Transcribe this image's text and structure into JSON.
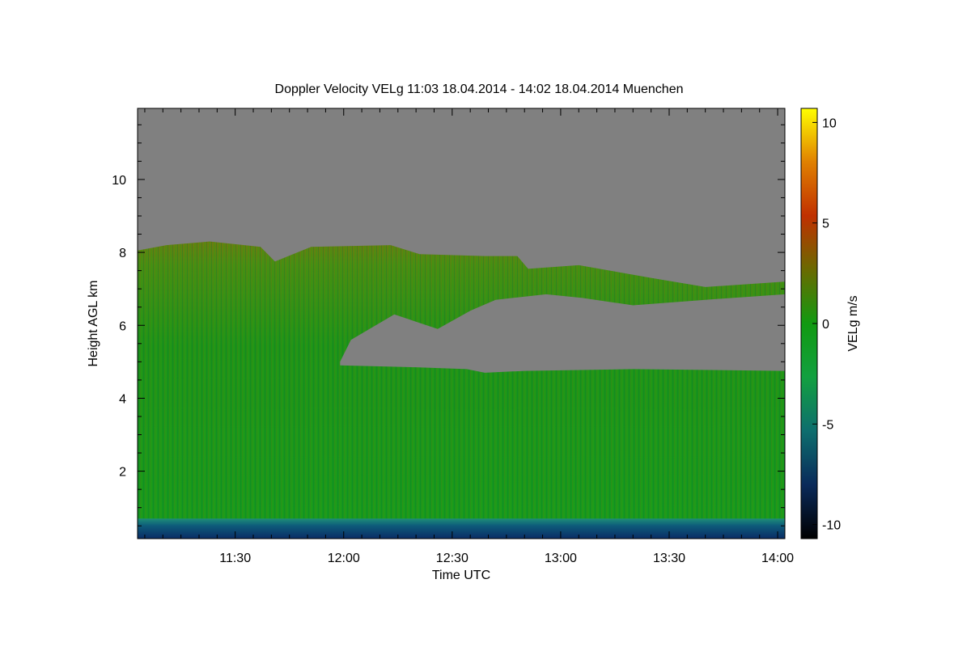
{
  "chart_data": {
    "type": "heatmap",
    "title": "Doppler Velocity VELg   11:03 18.04.2014 - 14:02 18.04.2014 Muenchen",
    "xlabel": "Time UTC",
    "ylabel": "Height AGL km",
    "colorbar_label": "VELg m/s",
    "x_range_min": [
      663,
      842
    ],
    "y_range_km": [
      0.15,
      11.95
    ],
    "color_range": [
      -10.7,
      10.7
    ],
    "x_ticks": [
      {
        "min": 690,
        "label": "11:30"
      },
      {
        "min": 720,
        "label": "12:00"
      },
      {
        "min": 750,
        "label": "12:30"
      },
      {
        "min": 780,
        "label": "13:00"
      },
      {
        "min": 810,
        "label": "13:30"
      },
      {
        "min": 840,
        "label": "14:00"
      }
    ],
    "y_ticks": [
      {
        "km": 2,
        "label": "2"
      },
      {
        "km": 4,
        "label": "4"
      },
      {
        "km": 6,
        "label": "6"
      },
      {
        "km": 8,
        "label": "8"
      },
      {
        "km": 10,
        "label": "10"
      }
    ],
    "colorbar_ticks": [
      {
        "v": 10,
        "label": "10"
      },
      {
        "v": 5,
        "label": "5"
      },
      {
        "v": 0,
        "label": "0"
      },
      {
        "v": -5,
        "label": "-5"
      },
      {
        "v": -10,
        "label": "-10"
      }
    ],
    "colormap": [
      "#000000",
      "#0a2a5a",
      "#0e6e6e",
      "#12a040",
      "#119a11",
      "#6a6a00",
      "#c03000",
      "#e08000",
      "#ffff00"
    ],
    "no_data_color": "#808080",
    "cloud_top_profile": [
      {
        "min": 663,
        "km": 8.05
      },
      {
        "min": 671,
        "km": 8.2
      },
      {
        "min": 683,
        "km": 8.3
      },
      {
        "min": 697,
        "km": 8.15
      },
      {
        "min": 701,
        "km": 7.75
      },
      {
        "min": 711,
        "km": 8.15
      },
      {
        "min": 733,
        "km": 8.2
      },
      {
        "min": 741,
        "km": 7.95
      },
      {
        "min": 759,
        "km": 7.9
      },
      {
        "min": 768,
        "km": 7.9
      },
      {
        "min": 771,
        "km": 7.55
      },
      {
        "min": 785,
        "km": 7.65
      },
      {
        "min": 805,
        "km": 7.3
      },
      {
        "min": 820,
        "km": 7.05
      },
      {
        "min": 842,
        "km": 7.2
      }
    ],
    "dry_gap_top_profile": [
      {
        "min": 719,
        "km": 5.0
      },
      {
        "min": 722,
        "km": 5.6
      },
      {
        "min": 734,
        "km": 6.3
      },
      {
        "min": 746,
        "km": 5.9
      },
      {
        "min": 755,
        "km": 6.4
      },
      {
        "min": 762,
        "km": 6.7
      },
      {
        "min": 776,
        "km": 6.85
      },
      {
        "min": 786,
        "km": 6.75
      },
      {
        "min": 800,
        "km": 6.55
      },
      {
        "min": 820,
        "km": 6.7
      },
      {
        "min": 842,
        "km": 6.85
      }
    ],
    "lower_cloud_top_profile": [
      {
        "min": 719,
        "km": 4.9
      },
      {
        "min": 740,
        "km": 4.85
      },
      {
        "min": 754,
        "km": 4.8
      },
      {
        "min": 759,
        "km": 4.7
      },
      {
        "min": 770,
        "km": 4.75
      },
      {
        "min": 800,
        "km": 4.8
      },
      {
        "min": 842,
        "km": 4.75
      }
    ]
  }
}
